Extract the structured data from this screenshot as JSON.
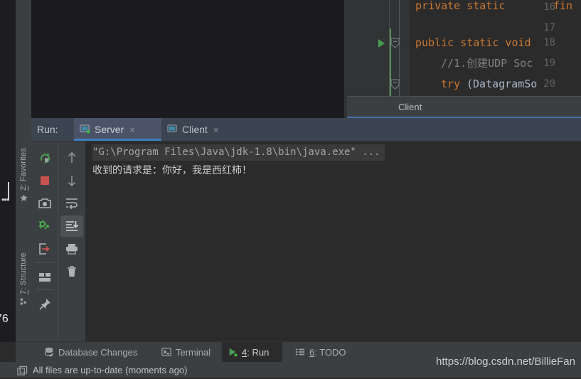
{
  "editor": {
    "tab_label": "Client",
    "lines": [
      {
        "number": "16",
        "text": "private static fin",
        "kind": "keyword-lead",
        "has_run_arrow": false,
        "has_fold": false
      },
      {
        "number": "17",
        "text": "",
        "kind": "empty",
        "has_run_arrow": false,
        "has_fold": false
      },
      {
        "number": "18",
        "text": "public static void",
        "kind": "keyword-lead",
        "has_run_arrow": true,
        "has_fold": true
      },
      {
        "number": "19",
        "text": "//1.创建UDP Soc",
        "kind": "comment",
        "has_run_arrow": false,
        "has_fold": false
      },
      {
        "number": "20",
        "text": "try(DatagramSo",
        "kind": "keyword-call",
        "has_run_arrow": false,
        "has_fold": true
      }
    ],
    "line16_kw": "private static ",
    "line16_rest": "fin",
    "line18_kw": "public static void",
    "line19_comment": "//1.创建UDP Soc",
    "line20_kw": "try",
    "line20_rest": "(DatagramSo"
  },
  "run_window": {
    "title": "Run:",
    "tabs": [
      {
        "label": "Server",
        "icon": "console-run-icon",
        "active": true,
        "close_glyph": "×",
        "running": true
      },
      {
        "label": "Client",
        "icon": "console-run-icon",
        "active": false,
        "close_glyph": "×",
        "running": false
      }
    ],
    "toolbar_left": [
      {
        "name": "rerun-icon",
        "title": "Rerun"
      },
      {
        "name": "stop-icon",
        "title": "Stop"
      },
      {
        "name": "camera-icon",
        "title": "Dump Threads"
      },
      {
        "name": "thread-dump-icon",
        "title": "Thread Dump"
      },
      {
        "name": "export-icon",
        "title": "Export"
      },
      {
        "name": "layout-icon",
        "title": "Layout Settings"
      },
      {
        "name": "pin-icon",
        "title": "Pin Tab"
      }
    ],
    "toolbar_right": [
      {
        "name": "arrow-up-icon",
        "title": "Up the Stack Trace"
      },
      {
        "name": "arrow-down-icon",
        "title": "Down the Stack Trace"
      },
      {
        "name": "soft-wrap-icon",
        "title": "Soft-Wrap"
      },
      {
        "name": "scroll-to-end-icon",
        "title": "Scroll to the End",
        "selected": true
      },
      {
        "name": "print-icon",
        "title": "Print"
      },
      {
        "name": "trash-icon",
        "title": "Clear All"
      }
    ]
  },
  "console": {
    "lines": [
      {
        "text": "\"G:\\Program Files\\Java\\jdk-1.8\\bin\\java.exe\" ...",
        "style": "command"
      },
      {
        "text": "收到的请求是：你好，我是西红柿！",
        "style": "output"
      }
    ],
    "caret_visible": true
  },
  "left_tool_bar": {
    "tabs": [
      {
        "label_prefix": "2",
        "label": ": Favorites",
        "icon": "star-icon"
      },
      {
        "label_prefix": "7",
        "label": ": Structure",
        "icon": "structure-icon"
      }
    ]
  },
  "bottom_tool_bar": {
    "items": [
      {
        "label": "Database Changes",
        "icon": "database-icon",
        "active": false,
        "num": ""
      },
      {
        "label": "Terminal",
        "icon": "terminal-icon",
        "active": false,
        "num": ""
      },
      {
        "label": ": Run",
        "num": "4",
        "icon": "run-icon",
        "active": true
      },
      {
        "label": ": TODO",
        "num": "6",
        "icon": "todo-list-icon",
        "active": false
      }
    ]
  },
  "status_bar": {
    "message": "All files are up-to-date (moments ago)",
    "icon": "copy-window-icon"
  },
  "watermark": {
    "text": "https://blog.csdn.net/BillieFan"
  },
  "artifacts": {
    "left_number": "76",
    "left_marks": "•••"
  },
  "colors": {
    "editor_bg": "#2b2b2b",
    "gutter_bg": "#313335",
    "panel_bg": "#3c3f41",
    "run_header_bg": "#3c4451",
    "tab_active_bg": "#4a5367",
    "tab_underline": "#3d7ec0",
    "keyword": "#cc7832",
    "plain_code": "#a9b7c6",
    "comment": "#808080",
    "run_green": "#499c54",
    "stop_red": "#c75450",
    "text_primary": "#bbbbbb",
    "text_muted": "#a9adb3"
  }
}
